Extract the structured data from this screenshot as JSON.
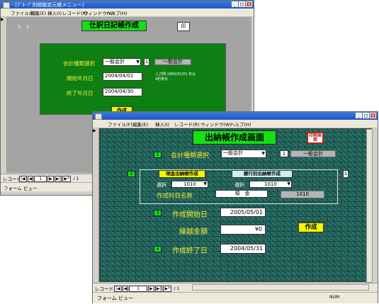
{
  "back_window": {
    "title": "- [ｸﾞﾙｰﾌﾟ別総勘定元帳メニュー]",
    "menu": [
      "ファイル(F)",
      "編集(E)",
      "挿入(I)",
      "レコード(R)",
      "ウィンドウ(W)",
      "ヘルプ(H)"
    ],
    "control_box_labels": [
      "_",
      "□",
      "×"
    ],
    "heading": "仕訳日記帳作成",
    "corner_button": "印",
    "ruler_numbers": [
      "5",
      "1"
    ],
    "account_type_label": "会計種類選択",
    "account_type_value": "一般会計",
    "account_type_mark": "1",
    "account_type_display": "一般会計",
    "start_label": "開始年月日",
    "start_value": "2004/04/01",
    "start_note": "入力例:1900/01/01 年は4桁表示",
    "end_label": "終了年月日",
    "end_value": "2004/04/30",
    "create_button": "作成",
    "record_label": "レコード:",
    "record_nav": [
      "|◀",
      "◀",
      "1",
      "▶",
      "▶|",
      "▶*"
    ],
    "record_total": "/ 1",
    "status_text": "フォーム ビュー"
  },
  "front_window": {
    "menu": [
      "ファイル(F)",
      "編集(E)",
      "挿入(I)",
      "レコード(R)",
      "ウィンドウ(W)",
      "ヘルプ(H)"
    ],
    "control_box_labels": [
      "_",
      "□",
      "×"
    ],
    "heading": "出納帳作成画面",
    "print_button": "印刷画面",
    "step1": "1",
    "account_type_label": "会計種類選択",
    "account_type_value": "一般会計",
    "account_type_mark": "1",
    "account_type_display": "一般会計",
    "step2": "2",
    "cash_tab": "現金出納帳作成",
    "bank_tab": "銀行別出納帳作成",
    "panel_mark": "1",
    "select_left_label": "選択",
    "select_left_value": "1010",
    "select_right_label": "選択",
    "select_right_value": "1010",
    "subject_label": "作成科目名称",
    "subject_value": "現　金",
    "subject_code": "1010",
    "step3": "3",
    "start_label": "作成開始日",
    "start_value": "2005/05/01",
    "balance_label": "繰越金額",
    "balance_value": "¥0",
    "create_button": "作成",
    "step4": "4",
    "end_label": "作成終了日",
    "end_value": "2004/05/31",
    "record_label": "レコード:",
    "record_nav": [
      "|◀",
      "◀",
      "1",
      "▶",
      "▶|",
      "▶*"
    ],
    "record_total": "/ 1",
    "status_text": "フォーム ビュー",
    "status_right": "NUM"
  },
  "colors": {
    "titlebar": "#2a64d0",
    "green_panel": "#0e7f12",
    "label_yellow": "#f1ec33",
    "teal_panel": "#1f5f58",
    "yellow_button": "#f6f600",
    "step_green": "#16e016"
  }
}
